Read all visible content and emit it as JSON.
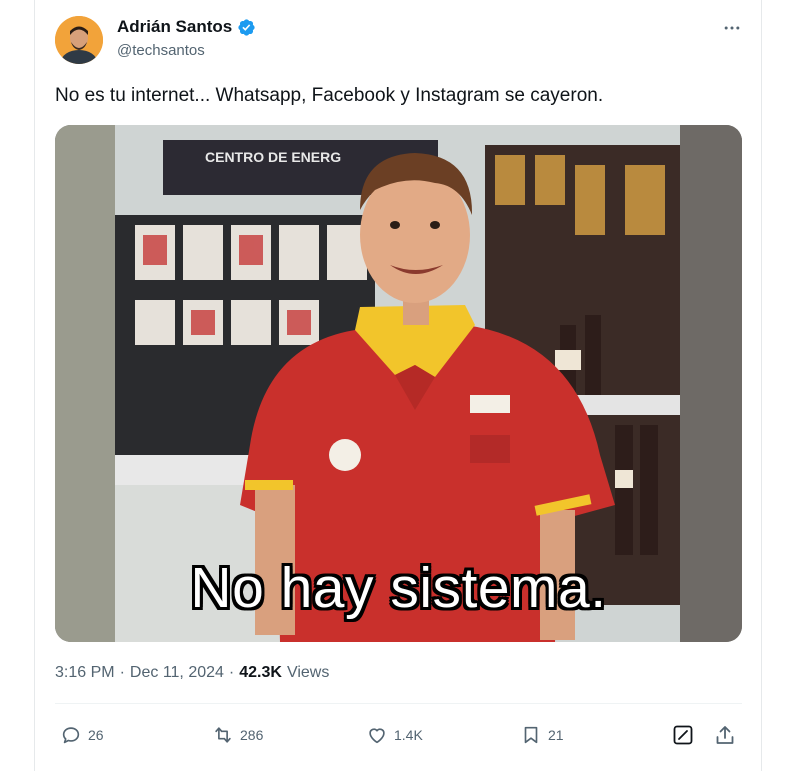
{
  "author": {
    "name": "Adrián Santos",
    "handle": "@techsantos",
    "verified": true
  },
  "tweet": {
    "text": "No es tu internet... Whatsapp, Facebook y Instagram se cayeron.",
    "image_caption": "No hay sistema.",
    "image_sign_text": "CENTRO DE ENERG"
  },
  "meta": {
    "time": "3:16 PM",
    "separator": "·",
    "date": "Dec 11, 2024",
    "views_count": "42.3K",
    "views_label": "Views"
  },
  "actions": {
    "replies": "26",
    "reposts": "286",
    "likes": "1.4K",
    "bookmarks": "21"
  },
  "icons": {
    "more": "more-horizontal-icon",
    "verified": "verified-badge-icon",
    "reply": "comment-bubble-icon",
    "repost": "repost-arrows-icon",
    "like": "heart-icon",
    "bookmark": "bookmark-icon",
    "grok": "grok-icon",
    "share": "share-icon"
  },
  "colors": {
    "text": "#0f1419",
    "secondary": "#536471",
    "verified": "#1d9bf0",
    "avatar_bg": "#f2a33a"
  }
}
